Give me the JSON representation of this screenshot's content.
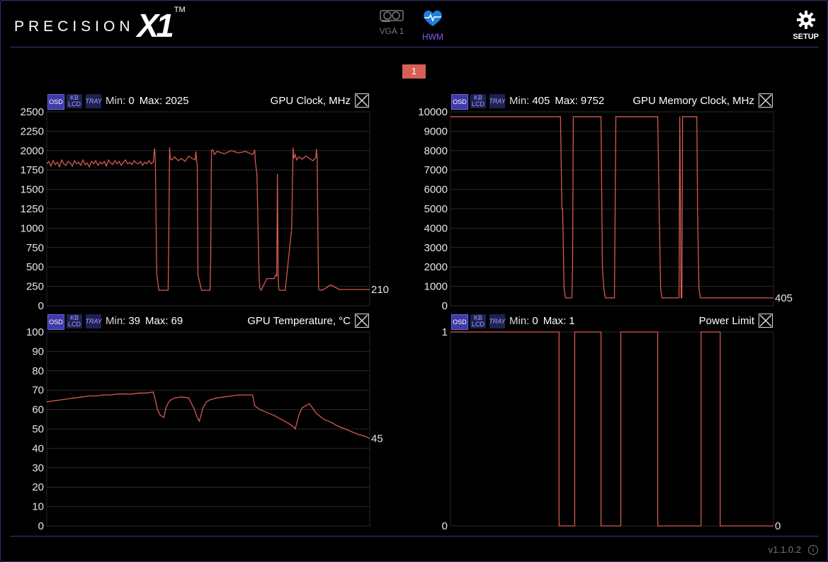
{
  "app": {
    "logo_word": "PRECISION",
    "logo_mark": "X1",
    "logo_tm": "TM",
    "accent": "#8a57ff",
    "line_color": "#d45a50"
  },
  "nav": {
    "vga_label": "VGA 1",
    "hwm_label": "HWM",
    "setup_label": "SETUP"
  },
  "page_badge": "1",
  "footer": {
    "version": "v1.1.0.2",
    "info_icon": "i"
  },
  "tags": {
    "osd": "OSD",
    "kb": "KB",
    "lcd": "LCD",
    "tray": "TRAY"
  },
  "panels": [
    {
      "title": "GPU Clock, MHz",
      "min_label": "Min:",
      "min": "0",
      "max_label": "Max:",
      "max": "2025",
      "current": "210"
    },
    {
      "title": "GPU Memory Clock, MHz",
      "min_label": "Min:",
      "min": "405",
      "max_label": "Max:",
      "max": "9752",
      "current": "405"
    },
    {
      "title": "GPU Temperature, °C",
      "min_label": "Min:",
      "min": "39",
      "max_label": "Max:",
      "max": "69",
      "current": "45"
    },
    {
      "title": "Power Limit",
      "min_label": "Min:",
      "min": "0",
      "max_label": "Max:",
      "max": "1",
      "current": "0"
    }
  ],
  "chart_data": [
    {
      "type": "line",
      "title": "GPU Clock, MHz",
      "ylim": [
        0,
        2500
      ],
      "yticks": [
        0,
        250,
        500,
        750,
        1000,
        1250,
        1500,
        1750,
        2000,
        2250,
        2500
      ],
      "grid": true,
      "series": [
        {
          "x": [
            0,
            3,
            6,
            9,
            12,
            15,
            18,
            21,
            24,
            27,
            30,
            33,
            36,
            39,
            42,
            45,
            48,
            51,
            54,
            57,
            60,
            63,
            66,
            69,
            72,
            75,
            78,
            81,
            84,
            87,
            90,
            93,
            96,
            99,
            102,
            105,
            108,
            111,
            114,
            117,
            120,
            123,
            126,
            129,
            132,
            135,
            138,
            141,
            144,
            147,
            150,
            152,
            153,
            155,
            158,
            170,
            171,
            172,
            173,
            174,
            176,
            180,
            185,
            190,
            195,
            200,
            205,
            209,
            210,
            212,
            213,
            218,
            230,
            231,
            232,
            234,
            236,
            240,
            250,
            260,
            270,
            280,
            290,
            292,
            293,
            294,
            296,
            299,
            300,
            302,
            310,
            320,
            323,
            324,
            325,
            326,
            327,
            328,
            336,
            345,
            347,
            348,
            350,
            352,
            355,
            360,
            365,
            370,
            375,
            379,
            380,
            381,
            382,
            383,
            385,
            390,
            400,
            412,
            414,
            417,
            420,
            425,
            455
          ],
          "values": [
            1830,
            1860,
            1800,
            1870,
            1820,
            1850,
            1790,
            1880,
            1830,
            1810,
            1860,
            1840,
            1800,
            1870,
            1830,
            1850,
            1810,
            1880,
            1820,
            1840,
            1790,
            1860,
            1830,
            1870,
            1810,
            1850,
            1830,
            1860,
            1800,
            1880,
            1840,
            1820,
            1870,
            1830,
            1860,
            1810,
            1850,
            1880,
            1830,
            1850,
            1820,
            1870,
            1840,
            1830,
            1860,
            1810,
            1850,
            1830,
            1870,
            1830,
            1850,
            2030,
            1880,
            400,
            200,
            200,
            200,
            1000,
            2040,
            1900,
            1880,
            1920,
            1870,
            1900,
            1860,
            1930,
            1900,
            1880,
            1990,
            1800,
            400,
            200,
            200,
            600,
            2000,
            2010,
            1950,
            1990,
            1960,
            2000,
            1970,
            1990,
            1950,
            1980,
            2010,
            1850,
            1700,
            400,
            230,
            200,
            350,
            350,
            400,
            380,
            1700,
            350,
            210,
            200,
            200,
            1000,
            2040,
            1900,
            1950,
            1880,
            1920,
            1890,
            1930,
            1900,
            1870,
            1910,
            2020,
            1880,
            1000,
            220,
            200,
            210,
            270,
            210,
            210,
            210,
            210,
            210,
            210
          ]
        }
      ]
    },
    {
      "type": "line",
      "title": "GPU Memory Clock, MHz",
      "ylim": [
        0,
        10000
      ],
      "yticks": [
        0,
        1000,
        2000,
        3000,
        4000,
        5000,
        6000,
        7000,
        8000,
        9000,
        10000
      ],
      "grid": true,
      "series": [
        {
          "x": [
            0,
            155,
            157,
            158,
            160,
            162,
            165,
            170,
            171,
            172,
            173,
            175,
            176,
            200,
            212,
            214,
            216,
            218,
            222,
            230,
            231,
            232,
            233,
            235,
            236,
            280,
            292,
            294,
            296,
            298,
            300,
            320,
            322,
            323,
            324,
            325,
            326,
            327,
            328,
            330,
            332,
            336,
            345,
            347,
            348,
            350,
            352,
            375,
            378,
            380,
            382,
            383,
            385,
            390,
            430,
            455
          ],
          "values": [
            9752,
            9752,
            5000,
            5000,
            900,
            405,
            405,
            405,
            405,
            2000,
            9752,
            9752,
            9752,
            9752,
            9752,
            2000,
            900,
            405,
            405,
            405,
            405,
            5000,
            9752,
            9752,
            9752,
            9752,
            9752,
            5000,
            900,
            405,
            405,
            405,
            405,
            9752,
            5000,
            405,
            405,
            9752,
            9752,
            9752,
            9752,
            9752,
            9752,
            9752,
            5000,
            900,
            405,
            405,
            405,
            405,
            405,
            405,
            405,
            405,
            405,
            405
          ]
        }
      ]
    },
    {
      "type": "line",
      "title": "GPU Temperature, °C",
      "ylim": [
        0,
        100
      ],
      "yticks": [
        0,
        10,
        20,
        30,
        40,
        50,
        60,
        70,
        80,
        90,
        100
      ],
      "grid": true,
      "series": [
        {
          "x": [
            0,
            10,
            20,
            30,
            40,
            50,
            60,
            70,
            80,
            90,
            100,
            110,
            120,
            130,
            140,
            150,
            153,
            156,
            160,
            165,
            168,
            172,
            175,
            180,
            190,
            200,
            208,
            212,
            215,
            220,
            225,
            230,
            240,
            250,
            260,
            270,
            280,
            290,
            293,
            300,
            310,
            320,
            330,
            340,
            348,
            350,
            355,
            360,
            365,
            370,
            380,
            390,
            400,
            410,
            420,
            430,
            440,
            450,
            455
          ],
          "values": [
            64,
            64.5,
            65,
            65.5,
            66,
            66.5,
            67,
            67,
            67.5,
            67.5,
            68,
            68,
            68,
            68.5,
            68.5,
            69,
            65,
            60,
            57,
            56,
            61,
            64,
            65,
            66,
            66.5,
            66,
            60,
            56,
            54,
            61,
            64,
            65,
            66,
            66.5,
            67,
            67.5,
            67.5,
            67.5,
            62,
            60,
            58.5,
            57,
            55,
            53,
            51,
            50,
            57,
            61,
            62,
            63,
            58,
            55,
            53.5,
            51.5,
            50,
            48.5,
            47,
            46,
            45
          ]
        }
      ]
    },
    {
      "type": "line",
      "title": "Power Limit",
      "ylim": [
        0,
        1
      ],
      "yticks": [
        0,
        1
      ],
      "grid": true,
      "series": [
        {
          "x": [
            0,
            153,
            153,
            175,
            175,
            212,
            212,
            240,
            240,
            292,
            292,
            353,
            353,
            380,
            380,
            455
          ],
          "values": [
            1,
            1,
            0,
            0,
            1,
            1,
            0,
            0,
            1,
            1,
            0,
            0,
            1,
            1,
            0,
            0
          ]
        }
      ]
    }
  ]
}
